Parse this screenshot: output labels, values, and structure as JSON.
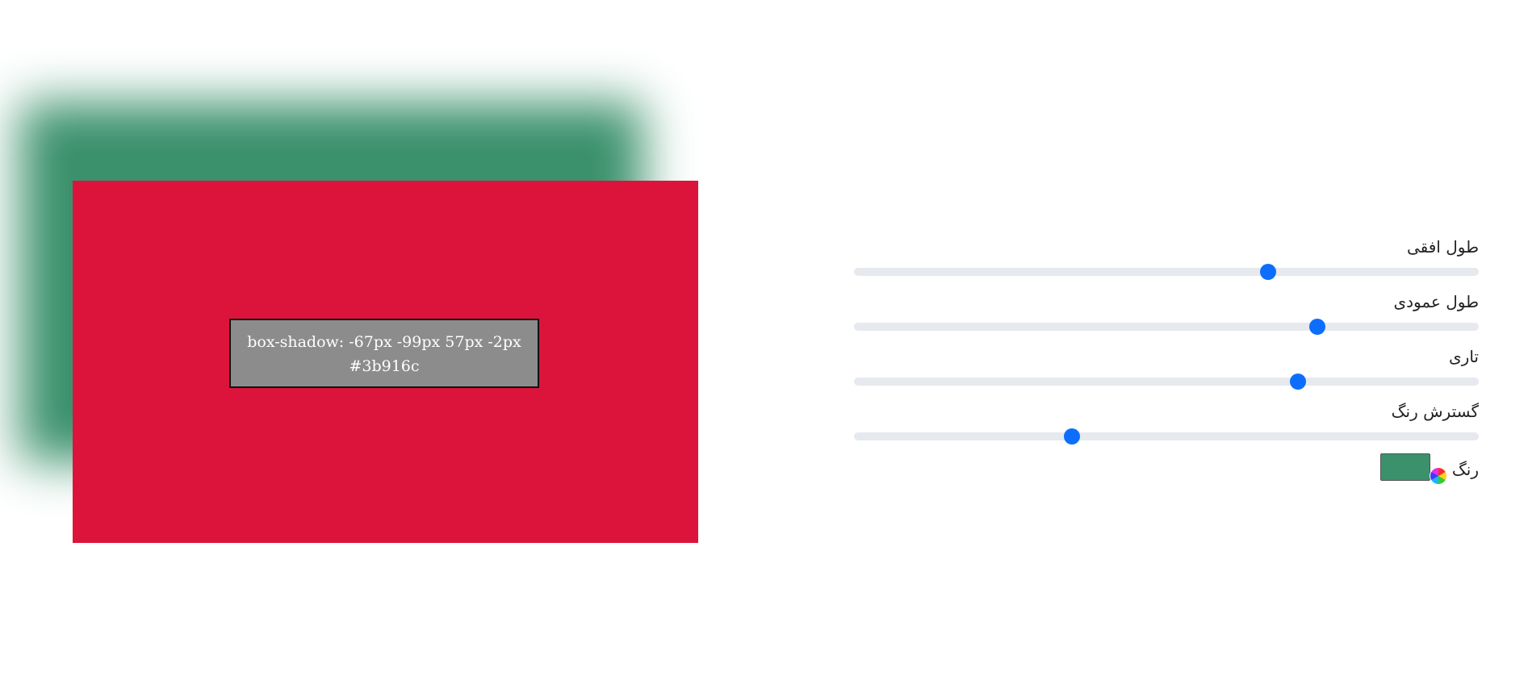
{
  "preview": {
    "code_line1": "box-shadow: -67px -99px 57px -2px",
    "code_line2": "#3b916c",
    "box_color": "#dc143c",
    "shadow_color": "#3b916c",
    "label_bg": "#8c8c8c"
  },
  "controls": {
    "sliders": [
      {
        "label": "طول افقی",
        "value": -67,
        "level": 0.663
      },
      {
        "label": "طول عمودی",
        "value": -99,
        "level": 0.741
      },
      {
        "label": "تاری",
        "value": 57,
        "level": 0.71
      },
      {
        "label": "گسترش رنگ",
        "value": -2,
        "level": 0.349
      }
    ],
    "color": {
      "label": "رنگ",
      "value": "#3b916c",
      "icon": "color-palette-icon"
    },
    "accent": "#0d6efd",
    "track_color": "#e6e9ed"
  }
}
